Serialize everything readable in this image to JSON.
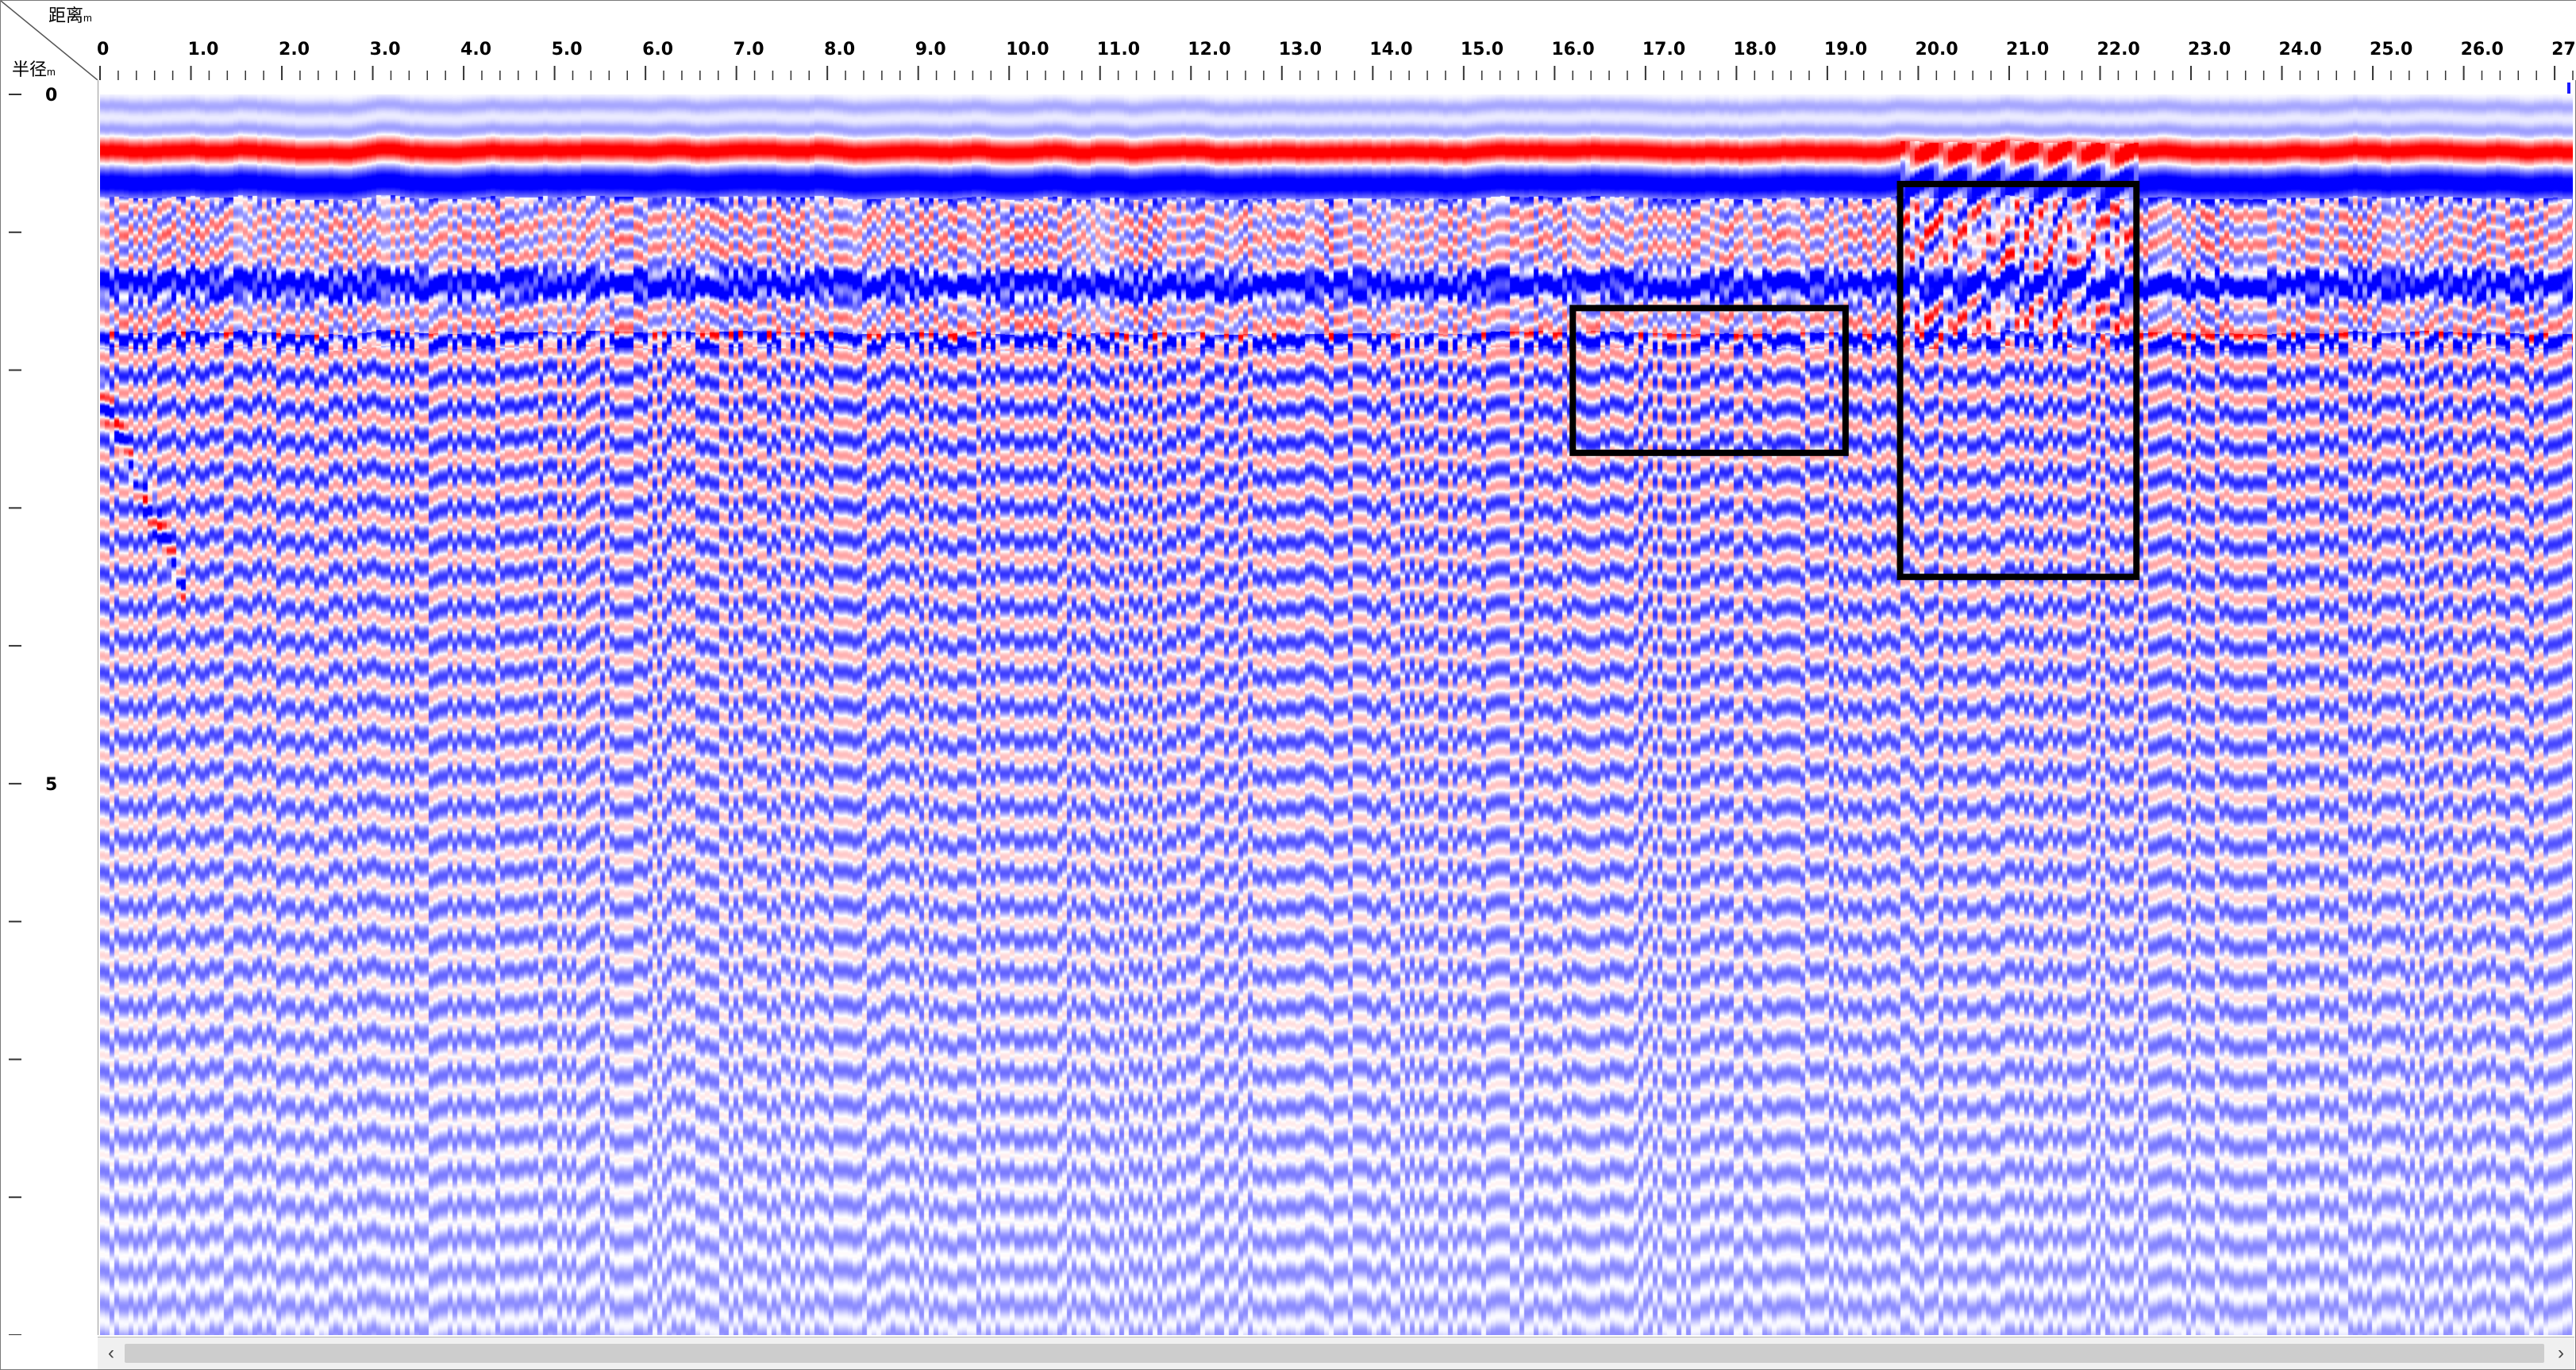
{
  "window": {
    "distance_label": "距离",
    "distance_unit": "m",
    "radius_label": "半径",
    "radius_unit": "m"
  },
  "x_axis": {
    "labels": [
      "0",
      "1.0",
      "2.0",
      "3.0",
      "4.0",
      "5.0",
      "6.0",
      "7.0",
      "8.0",
      "9.0",
      "10.0",
      "11.0",
      "12.0",
      "13.0",
      "14.0",
      "15.0",
      "16.0",
      "17.0",
      "18.0",
      "19.0",
      "20.0",
      "21.0",
      "22.0",
      "23.0",
      "24.0",
      "25.0",
      "26.0",
      "27"
    ],
    "range": [
      0,
      27.2
    ],
    "minor_ticks_per_unit": 5
  },
  "y_axis": {
    "labels": [
      "0",
      "5"
    ],
    "label_values": [
      0,
      5
    ],
    "major_tick_values": [
      0,
      1,
      2,
      3,
      4,
      5,
      6,
      7,
      8,
      9
    ],
    "range": [
      0,
      9
    ]
  },
  "scan": {
    "palette": {
      "negative": "#0000ff",
      "neutral": "#ffffff",
      "positive": "#ff0000"
    },
    "annotations": [
      {
        "name": "anomaly-box-1",
        "x_range": [
          16.2,
          19.2
        ],
        "depth_range": [
          1.55,
          2.6
        ]
      },
      {
        "name": "anomaly-box-2",
        "x_range": [
          19.8,
          22.4
        ],
        "depth_range": [
          0.65,
          3.5
        ]
      }
    ]
  },
  "colors": {
    "frame": "#7a7a7a",
    "ruler_bg": "#ffffff",
    "scroll_bg": "#f0f0f0",
    "marker": "#1a1aff"
  }
}
